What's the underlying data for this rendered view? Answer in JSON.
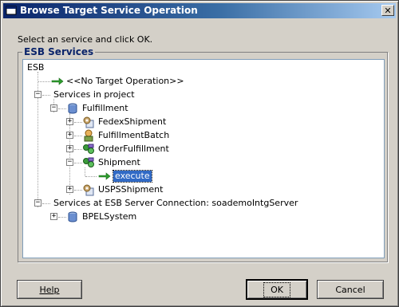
{
  "window": {
    "title": "Browse Target Service Operation"
  },
  "instruction": "Select an service and click OK.",
  "group": {
    "label": "ESB Services"
  },
  "tree": {
    "esb": "ESB",
    "no_target": "<<No Target Operation>>",
    "services_in_project": "Services in project",
    "fulfillment": "Fulfillment",
    "fedex": "FedexShipment",
    "fulfillment_batch": "FulfillmentBatch",
    "order_fulfillment": "OrderFulfillment",
    "shipment": "Shipment",
    "execute": "execute",
    "usps": "USPSShipment",
    "server_services": "Services at ESB Server Connection: soademoIntgServer",
    "bpel_system": "BPELSystem"
  },
  "buttons": {
    "help": "Help",
    "ok": "OK",
    "cancel": "Cancel"
  },
  "colors": {
    "selection": "#316ac5",
    "title_start": "#0a246a",
    "group_label": "#0a246a",
    "arrow": "#2e9e2e"
  }
}
